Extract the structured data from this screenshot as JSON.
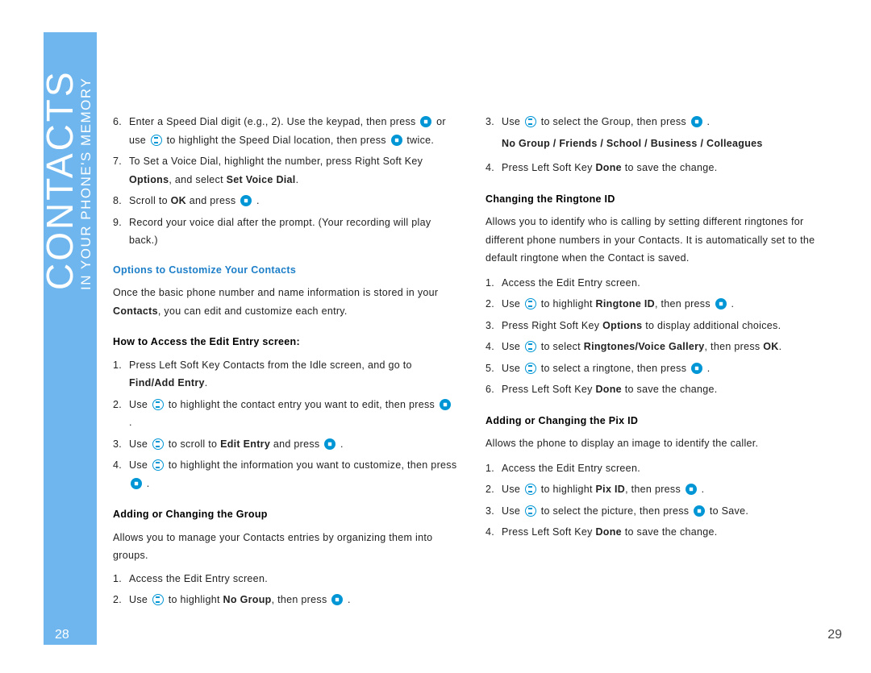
{
  "sidebar": {
    "title": "CONTACTS",
    "subtitle": "IN YOUR PHONE'S MEMORY"
  },
  "pages": {
    "left": "28",
    "right": "29"
  },
  "left": {
    "i6_a": "Enter a Speed Dial digit (e.g., 2). Use the keypad, then press",
    "i6_b": "or use",
    "i6_c": "to highlight the Speed Dial location, then press",
    "i6_d": "twice.",
    "i7_a": "To Set a Voice Dial, highlight the number, press Right Soft Key",
    "i7_b": "Options",
    "i7_c": ", and select",
    "i7_d": "Set Voice Dial",
    "i8_a": "Scroll to",
    "i8_b": "OK",
    "i8_c": "and press",
    "i9": "Record your voice dial after the prompt. (Your recording will play back.)",
    "h_options": "Options to Customize Your Contacts",
    "p_options_a": "Once the basic phone number and name information is stored in your",
    "p_options_b": "Contacts",
    "p_options_c": ", you can edit and customize each entry.",
    "h_edit": "How to Access the Edit Entry screen:",
    "e1_a": "Press Left Soft Key Contacts from the Idle screen, and go to",
    "e1_b": "Find/Add Entry",
    "e2_a": "Use",
    "e2_b": "to highlight the contact entry you want to edit, then press",
    "e3_a": "Use",
    "e3_b": "to scroll to",
    "e3_c": "Edit Entry",
    "e3_d": "and press",
    "e4_a": "Use",
    "e4_b": "to highlight the information you want to customize, then press",
    "h_group": "Adding or Changing the Group",
    "p_group": "Allows you to manage your Contacts entries by organizing them into groups.",
    "g1": "Access the Edit Entry screen.",
    "g2_a": "Use",
    "g2_b": "to highlight",
    "g2_c": "No Group",
    "g2_d": ", then press"
  },
  "right": {
    "r3_a": "Use",
    "r3_b": "to select the Group, then press",
    "groups": "No Group / Friends / School / Business / Colleagues",
    "r4_a": "Press Left Soft Key",
    "r4_b": "Done",
    "r4_c": "to save the change.",
    "h_ring": "Changing the Ringtone ID",
    "p_ring": "Allows you to identify who is calling by setting different ringtones for different phone numbers in your Contacts. It is automatically set to the default ringtone when the Contact is saved.",
    "ri1": "Access the Edit Entry screen.",
    "ri2_a": "Use",
    "ri2_b": "to highlight",
    "ri2_c": "Ringtone ID",
    "ri2_d": ", then press",
    "ri3_a": "Press Right Soft Key",
    "ri3_b": "Options",
    "ri3_c": "to display additional choices.",
    "ri4_a": "Use",
    "ri4_b": "to select",
    "ri4_c": "Ringtones/Voice Gallery",
    "ri4_d": ", then press",
    "ri4_e": "OK",
    "ri5_a": "Use",
    "ri5_b": "to select a ringtone, then press",
    "ri6_a": "Press Left Soft Key",
    "ri6_b": "Done",
    "ri6_c": "to save the change.",
    "h_pix": "Adding or Changing the Pix ID",
    "p_pix": "Allows the phone to display an image to identify the caller.",
    "px1": "Access the Edit Entry screen.",
    "px2_a": "Use",
    "px2_b": "to highlight",
    "px2_c": "Pix ID",
    "px2_d": ", then press",
    "px3_a": "Use",
    "px3_b": "to select the picture, then press",
    "px3_c": "to Save.",
    "px4_a": "Press Left Soft Key",
    "px4_b": "Done",
    "px4_c": "to save the change."
  }
}
